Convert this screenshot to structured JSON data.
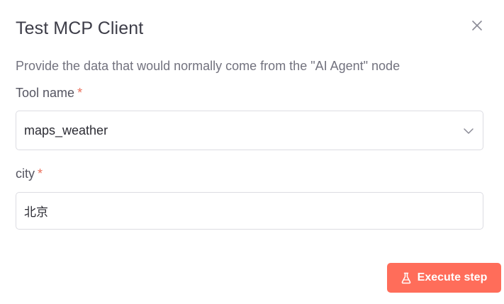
{
  "dialog": {
    "title": "Test MCP Client",
    "close_icon": "close-icon",
    "description": "Provide the data that would normally come from the \"AI Agent\" node"
  },
  "fields": {
    "tool_name": {
      "label": "Tool name",
      "required_mark": "*",
      "value": "maps_weather",
      "icon": "chevron-down-icon"
    },
    "city": {
      "label": "city",
      "required_mark": "*",
      "value": "北京"
    }
  },
  "actions": {
    "execute_label": "Execute step",
    "execute_icon": "flask-icon"
  },
  "colors": {
    "accent": "#ff6d5a",
    "required": "#ea6f5a",
    "border": "#dcdce2"
  }
}
